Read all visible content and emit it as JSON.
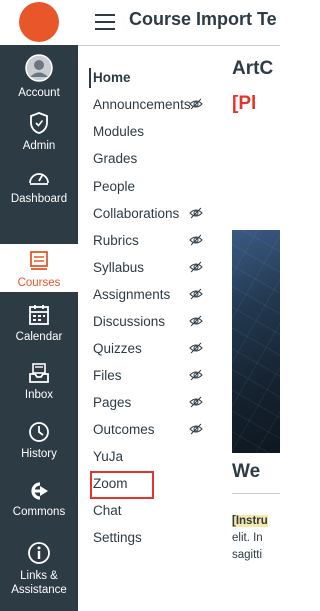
{
  "app": {
    "brand_color": "#e8572a",
    "nav_bg": "#2d3b45"
  },
  "header": {
    "course_title": "Course Import Te"
  },
  "global_nav": [
    {
      "id": "account",
      "label": "Account",
      "icon": "account-avatar-icon"
    },
    {
      "id": "admin",
      "label": "Admin",
      "icon": "admin-shield-icon"
    },
    {
      "id": "dashboard",
      "label": "Dashboard",
      "icon": "dashboard-gauge-icon"
    },
    {
      "id": "courses",
      "label": "Courses",
      "icon": "courses-book-icon",
      "active": true
    },
    {
      "id": "calendar",
      "label": "Calendar",
      "icon": "calendar-icon"
    },
    {
      "id": "inbox",
      "label": "Inbox",
      "icon": "inbox-icon"
    },
    {
      "id": "history",
      "label": "History",
      "icon": "history-clock-icon"
    },
    {
      "id": "commons",
      "label": "Commons",
      "icon": "commons-arrow-icon"
    },
    {
      "id": "links",
      "label": "Links &",
      "label2": "Assistance",
      "icon": "info-icon"
    }
  ],
  "course_nav": [
    {
      "label": "Home",
      "active": true,
      "hidden": false
    },
    {
      "label": "Announcements",
      "hidden": true
    },
    {
      "label": "Modules",
      "hidden": false
    },
    {
      "label": "Grades",
      "hidden": false
    },
    {
      "label": "People",
      "hidden": false
    },
    {
      "label": "Collaborations",
      "hidden": true
    },
    {
      "label": "Rubrics",
      "hidden": true
    },
    {
      "label": "Syllabus",
      "hidden": true
    },
    {
      "label": "Assignments",
      "hidden": true
    },
    {
      "label": "Discussions",
      "hidden": true
    },
    {
      "label": "Quizzes",
      "hidden": true
    },
    {
      "label": "Files",
      "hidden": true
    },
    {
      "label": "Pages",
      "hidden": true
    },
    {
      "label": "Outcomes",
      "hidden": true
    },
    {
      "label": "YuJa",
      "hidden": false
    },
    {
      "label": "Zoom",
      "hidden": false,
      "highlighted": true,
      "highlight_color": "#e5342b"
    },
    {
      "label": "Chat",
      "hidden": false
    },
    {
      "label": "Settings",
      "hidden": false
    }
  ],
  "content": {
    "heading": "ArtC",
    "placeholder": "[Pl",
    "welcome": "We",
    "body_line1_bold": "[Instru",
    "body_line2": "elit. In",
    "body_line3": "sagitti"
  }
}
